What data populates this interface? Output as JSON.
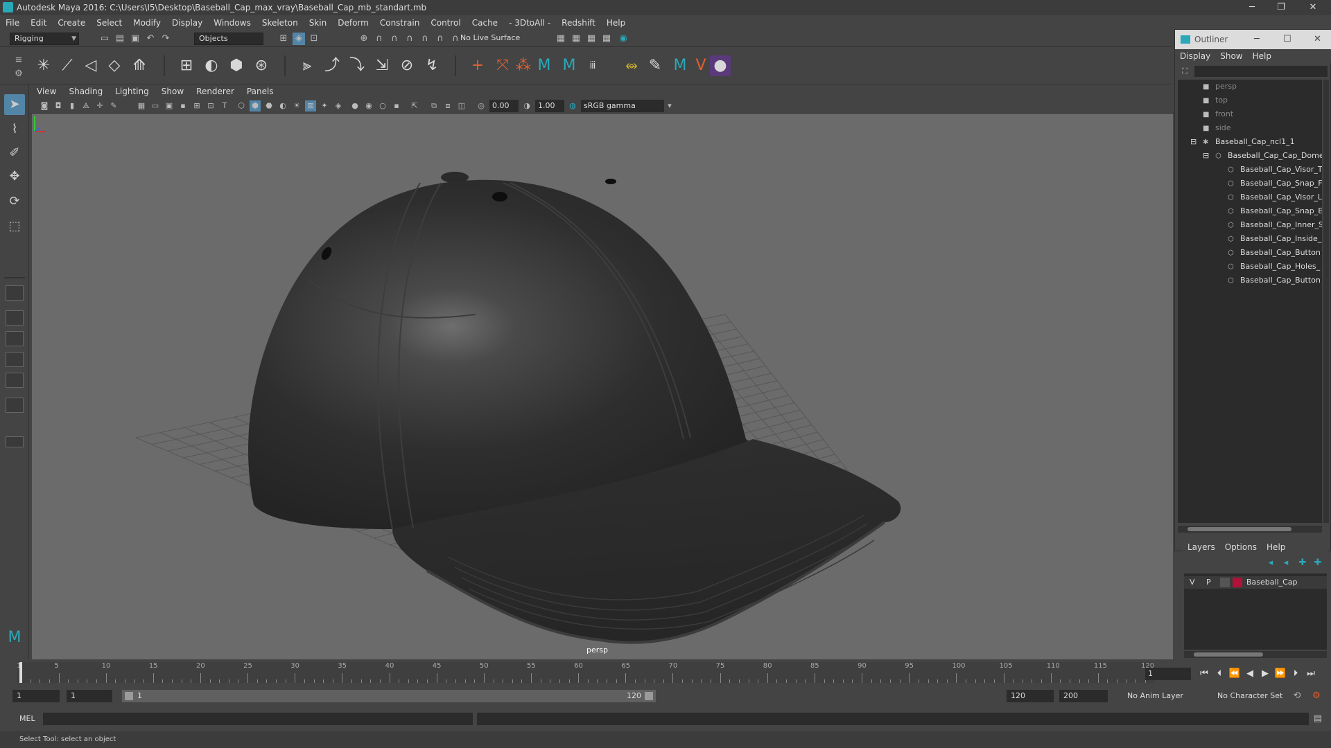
{
  "window": {
    "title": "Autodesk Maya 2016: C:\\Users\\I5\\Desktop\\Baseball_Cap_max_vray\\Baseball_Cap_mb_standart.mb",
    "minimize": "─",
    "restore": "❐",
    "close": "✕"
  },
  "menubar": [
    "File",
    "Edit",
    "Create",
    "Select",
    "Modify",
    "Display",
    "Windows",
    "Skeleton",
    "Skin",
    "Deform",
    "Constrain",
    "Control",
    "Cache",
    "- 3DtoAll -",
    "Redshift",
    "Help"
  ],
  "statusline": {
    "menuset": "Rigging",
    "select_mode": "Objects",
    "live_surface": "No Live Surface"
  },
  "panel": {
    "menus": [
      "View",
      "Shading",
      "Lighting",
      "Show",
      "Renderer",
      "Panels"
    ],
    "near_value": "0.00",
    "far_value": "1.00",
    "color_space": "sRGB gamma",
    "camera_label": "persp"
  },
  "outliner": {
    "title": "Outliner",
    "menus": [
      "Display",
      "Show",
      "Help"
    ],
    "items": [
      {
        "label": "persp",
        "type": "camera",
        "depth": 0
      },
      {
        "label": "top",
        "type": "camera",
        "depth": 0
      },
      {
        "label": "front",
        "type": "camera",
        "depth": 0
      },
      {
        "label": "side",
        "type": "camera",
        "depth": 0
      },
      {
        "label": "Baseball_Cap_ncl1_1",
        "type": "group",
        "depth": 0
      },
      {
        "label": "Baseball_Cap_Cap_Dome",
        "type": "mesh",
        "depth": 1
      },
      {
        "label": "Baseball_Cap_Visor_T",
        "type": "mesh",
        "depth": 2
      },
      {
        "label": "Baseball_Cap_Snap_F",
        "type": "mesh",
        "depth": 2
      },
      {
        "label": "Baseball_Cap_Visor_L",
        "type": "mesh",
        "depth": 2
      },
      {
        "label": "Baseball_Cap_Snap_E",
        "type": "mesh",
        "depth": 2
      },
      {
        "label": "Baseball_Cap_Inner_S",
        "type": "mesh",
        "depth": 2
      },
      {
        "label": "Baseball_Cap_Inside_",
        "type": "mesh",
        "depth": 2
      },
      {
        "label": "Baseball_Cap_Button",
        "type": "mesh",
        "depth": 2
      },
      {
        "label": "Baseball_Cap_Holes_",
        "type": "mesh",
        "depth": 2
      },
      {
        "label": "Baseball_Cap_Button",
        "type": "mesh",
        "depth": 2
      }
    ]
  },
  "layers": {
    "menus": [
      "Layers",
      "Options",
      "Help"
    ],
    "rows": [
      {
        "v": "V",
        "p": "P",
        "color": "#b0123a",
        "name": "Baseball_Cap"
      }
    ]
  },
  "timeline": {
    "ticks": [
      "1",
      "5",
      "10",
      "15",
      "20",
      "25",
      "30",
      "35",
      "40",
      "45",
      "50",
      "55",
      "60",
      "65",
      "70",
      "75",
      "80",
      "85",
      "90",
      "95",
      "100",
      "105",
      "110",
      "115",
      "120"
    ],
    "current_frame": "1",
    "start_min": "1",
    "start": "1",
    "range_start_label": "1",
    "range_end_label": "120",
    "end": "120",
    "end_max": "200",
    "anim_layer": "No Anim Layer",
    "character_set": "No Character Set"
  },
  "cmdline": {
    "label": "MEL"
  },
  "helpline": {
    "text": "Select Tool: select an object"
  },
  "colors": {
    "accent": "#5285a6",
    "layer": "#b0123a",
    "maya_teal": "#2aa8b8"
  }
}
